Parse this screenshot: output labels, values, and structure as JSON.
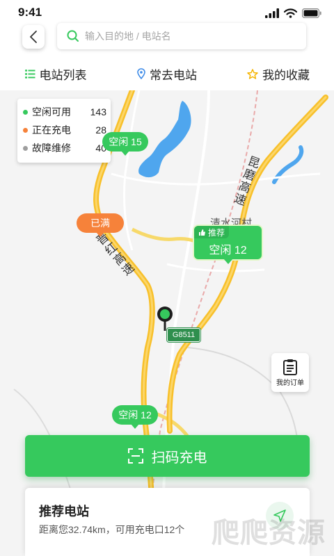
{
  "status_bar": {
    "time": "9:41"
  },
  "search": {
    "placeholder": "输入目的地 / 电站名"
  },
  "tabs": [
    {
      "label": "电站列表",
      "icon": "list-icon"
    },
    {
      "label": "常去电站",
      "icon": "location-pin-icon"
    },
    {
      "label": "我的收藏",
      "icon": "star-icon"
    }
  ],
  "legend": [
    {
      "label": "空闲可用",
      "count": "143",
      "color": "#36c95d"
    },
    {
      "label": "正在充电",
      "count": "28",
      "color": "#f6823a"
    },
    {
      "label": "故障维修",
      "count": "40",
      "color": "#9e9e9e"
    }
  ],
  "map": {
    "labels": {
      "road_1": "晋红高速",
      "road_2": "昆磨高速",
      "village": "清水河村",
      "highway_shield": "G8511"
    },
    "markers": [
      {
        "label": "空闲 15",
        "status": "free"
      },
      {
        "label": "已满",
        "status": "full"
      },
      {
        "label": "空闲 12",
        "status": "free"
      }
    ],
    "recommended_marker": {
      "tag": "推荐",
      "label": "空闲 12"
    }
  },
  "orders_button": {
    "label": "我的订单"
  },
  "scan_button": {
    "label": "扫码充电"
  },
  "recommend_card": {
    "title": "推荐电站",
    "subtitle": "距离您32.74km，可用充电口12个"
  },
  "watermark": "爬爬资源",
  "colors": {
    "primary": "#36c95d",
    "full": "#f6823a",
    "fault": "#9e9e9e",
    "road": "#f8c02a"
  }
}
